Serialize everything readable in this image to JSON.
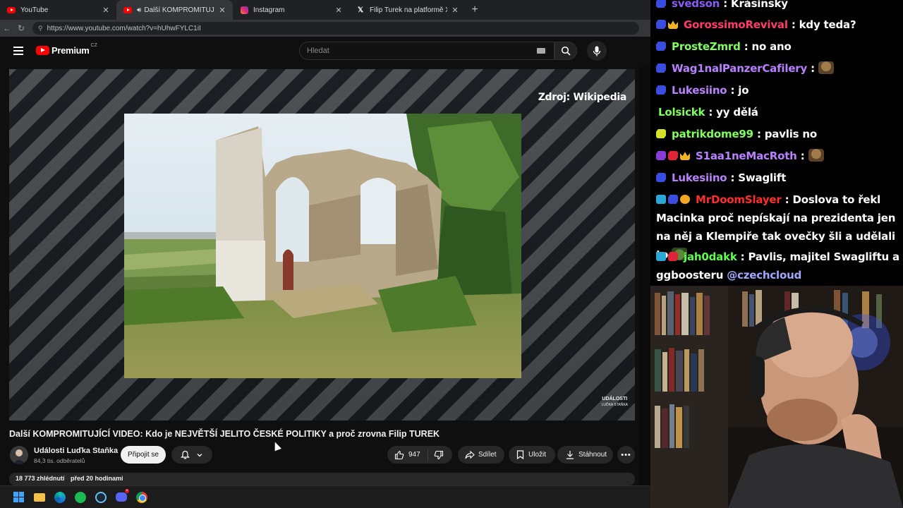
{
  "browser": {
    "tabs": [
      {
        "title": "YouTube",
        "icon": "youtube-icon",
        "active": false
      },
      {
        "title": "Další KOMPROMITUJÍCÍ VIDEO",
        "icon": "youtube-icon",
        "active": true,
        "audio": true
      },
      {
        "title": "Instagram",
        "icon": "instagram-icon",
        "active": false
      },
      {
        "title": "Filip Turek na platformě X: „Jednal",
        "icon": "x-icon",
        "active": false
      }
    ],
    "url": "https://www.youtube.com/watch?v=hUhwFYLC1iI"
  },
  "youtube": {
    "brand": "Premium",
    "brand_region": "CZ",
    "search_placeholder": "Hledat",
    "video": {
      "source_label": "Zdroj: Wikipedia",
      "watermark_line1": "UDÁLOSTI",
      "watermark_line2": "LUĎKA STAŇKA",
      "title": "Další KOMPROMITUJÍCÍ VIDEO: Kdo je NEJVĚTŠÍ JELITO ČESKÉ POLITIKY a proč zrovna Filip TUREK",
      "views": "18 773 zhlédnutí",
      "age": "před 20 hodinami"
    },
    "channel": {
      "name": "Události Luďka Staňka",
      "subscribers": "84,3 tis. odběratelů",
      "join_label": "Připojit se"
    },
    "actions": {
      "likes": "947",
      "share": "Sdílet",
      "save": "Uložit",
      "download": "Stáhnout"
    }
  },
  "chat": {
    "messages": [
      {
        "user": "svedson",
        "text": ": Krásinský",
        "color": "#8a5cf6"
      },
      {
        "user": "GorossimoRevival",
        "text": ": kdy teda?",
        "color": "#ff3b6b"
      },
      {
        "user": "ProsteZmrd",
        "text": ": no ano",
        "color": "#7fff5a"
      },
      {
        "user": "Wag1nalPanzerCafilery",
        "text": ":",
        "color": "#b980ff"
      },
      {
        "user": "Lukesiino",
        "text": ": jo",
        "color": "#b980ff"
      },
      {
        "user": "Lolsickk",
        "text": ": yy dělá",
        "color": "#7fff5a"
      },
      {
        "user": "patrikdome99",
        "text": ": pavlis no",
        "color": "#7fff5a"
      },
      {
        "user": "S1aa1neMacRoth",
        "text": ":",
        "color": "#b980ff"
      },
      {
        "user": "Lukesiino",
        "text": ": Swaglift",
        "color": "#b980ff"
      },
      {
        "user": "MrDoomSlayer",
        "text": ": Doslova to řekl Macinka proč nepískají na prezidenta jen na něj a Klempiře tak ovečky šli a udělali to",
        "color": "#ff2d2d"
      },
      {
        "user": "jah0dakk",
        "text": ": Pavlis, majitel Swagliftu a ggboosteru",
        "mention": "@czechcloud",
        "color": "#5dff4b"
      }
    ]
  },
  "colors": {
    "yt_red": "#ff0000",
    "accent_blue": "#3ea6ff"
  }
}
